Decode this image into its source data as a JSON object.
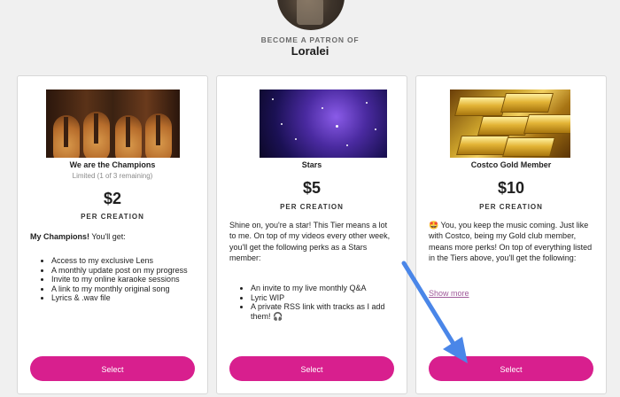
{
  "header": {
    "become_label": "BECOME A PATRON OF",
    "creator_name": "Loralei"
  },
  "tiers": [
    {
      "title": "We are the Champions",
      "limited": "Limited (1 of 3 remaining)",
      "price": "$2",
      "per": "PER CREATION",
      "intro_bold": "My Champions!",
      "intro_rest": " You'll get:",
      "perks": [
        "Access to my exclusive Lens",
        "A monthly update post on my progress",
        "Invite to my online karaoke sessions",
        "A link to my monthly original song",
        "Lyrics & .wav file"
      ],
      "select_label": "Select"
    },
    {
      "title": "Stars",
      "price": "$5",
      "per": "PER CREATION",
      "description": "Shine on, you're a star! This Tier means a lot to me. On top of my videos every other week, you'll get the following perks as a Stars member:",
      "perks": [
        "An invite to my live monthly Q&A",
        "Lyric WIP",
        "A private RSS link with tracks as I add them! 🎧"
      ],
      "select_label": "Select"
    },
    {
      "title": "Costco Gold Member",
      "price": "$10",
      "per": "PER CREATION",
      "description": "🤩 You,  you keep the music coming. Just like with Costco, being my Gold club member, means more perks! On top of everything listed in the Tiers above, you'll get the following:",
      "show_more": "Show more",
      "select_label": "Select"
    }
  ],
  "colors": {
    "select_button": "#d81f8e",
    "arrow": "#4a86e8",
    "show_more_link": "#a05a9a"
  }
}
